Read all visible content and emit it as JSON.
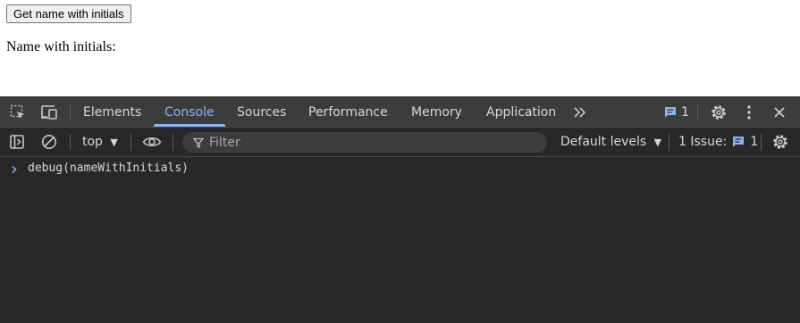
{
  "page": {
    "button_label": "Get name with initials",
    "result_label": "Name with initials:"
  },
  "devtools": {
    "tabs": [
      {
        "label": "Elements"
      },
      {
        "label": "Console"
      },
      {
        "label": "Sources"
      },
      {
        "label": "Performance"
      },
      {
        "label": "Memory"
      },
      {
        "label": "Application"
      }
    ],
    "active_tab": "Console",
    "issue_badge_count": "1",
    "toolbar": {
      "context": "top",
      "filter_placeholder": "Filter",
      "levels": "Default levels",
      "issues_label": "1 Issue:",
      "issues_count": "1"
    },
    "console_lines": [
      {
        "text": "debug(nameWithInitials)"
      }
    ],
    "colors": {
      "accent": "#8ab4f8",
      "panel_bg": "#282828",
      "tabbar_bg": "#3c3c3c",
      "text": "#d7d7d7"
    },
    "icons": [
      "inspect-element-icon",
      "device-toolbar-icon",
      "more-tabs-icon",
      "message-icon",
      "settings-gear-icon",
      "kebab-menu-icon",
      "close-icon",
      "sidebar-toggle-icon",
      "clear-console-icon",
      "eye-icon",
      "filter-funnel-icon",
      "dropdown-caret-icon"
    ]
  }
}
